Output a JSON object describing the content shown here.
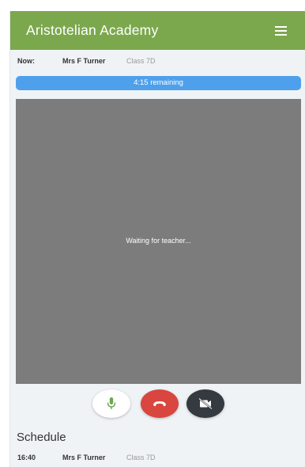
{
  "app": {
    "title": "Aristotelian Academy",
    "menu_icon": "hamburger-menu-icon"
  },
  "now": {
    "label": "Now:",
    "teacher": "Mrs F Turner",
    "class": "Class 7D"
  },
  "timer": {
    "text": "4:15 remaining"
  },
  "video": {
    "status_text": "Waiting for teacher..."
  },
  "controls": {
    "mic_icon": "microphone-icon",
    "hangup_icon": "phone-hangup-icon",
    "camera_icon": "camera-off-icon"
  },
  "schedule": {
    "title": "Schedule",
    "items": [
      {
        "time": "16:40",
        "teacher": "Mrs F Turner",
        "class": "Class 7D"
      }
    ]
  },
  "colors": {
    "header": "#7ba84d",
    "timer_bar": "#4ea0ec",
    "video_bg": "#7c7c7c",
    "mic_icon": "#6aa84f",
    "hangup": "#d9453f",
    "camera": "#343a40"
  }
}
